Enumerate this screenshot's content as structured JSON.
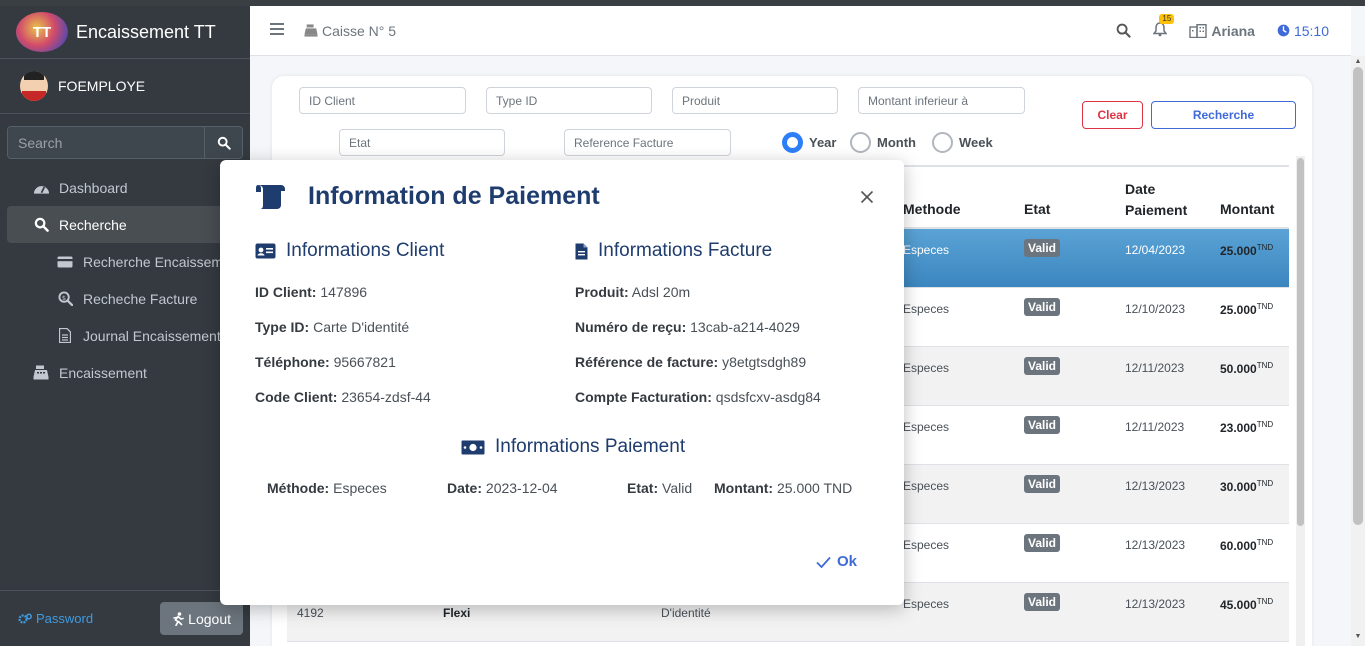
{
  "app": {
    "title": "Encaissement TT",
    "logo_text": "TT"
  },
  "user": {
    "name": "FOEMPLOYE"
  },
  "sidebar": {
    "search_placeholder": "Search",
    "items": [
      {
        "label": "Dashboard",
        "icon": "dashboard-icon"
      },
      {
        "label": "Recherche",
        "icon": "search-icon"
      },
      {
        "label": "Recherche Encaissement",
        "icon": "credit-card-icon"
      },
      {
        "label": "Recheche Facture",
        "icon": "search-dollar-icon"
      },
      {
        "label": "Journal Encaissement",
        "icon": "file-icon"
      },
      {
        "label": "Encaissement",
        "icon": "cash-register-icon"
      }
    ],
    "password_label": "Password",
    "logout_label": "Logout"
  },
  "header": {
    "caisse": "Caisse N° 5",
    "notif_count": "15",
    "location": "Ariana",
    "time": "15:10"
  },
  "filters": {
    "id_client_ph": "ID Client",
    "type_id_ph": "Type ID",
    "produit_ph": "Produit",
    "montant_ph": "Montant inferieur à",
    "etat_ph": "Etat",
    "ref_ph": "Reference Facture",
    "radio_year": "Year",
    "radio_month": "Month",
    "radio_week": "Week",
    "clear_label": "Clear",
    "search_label": "Recherche"
  },
  "table": {
    "headers": {
      "methode": "Methode",
      "etat": "Etat",
      "date": "Date Paiement",
      "montant": "Montant"
    },
    "currency": "TND",
    "rows": [
      {
        "methode": "Especes",
        "etat": "Valid",
        "date": "12/04/2023",
        "montant": "25.000"
      },
      {
        "methode": "Especes",
        "etat": "Valid",
        "date": "12/10/2023",
        "montant": "25.000"
      },
      {
        "methode": "Especes",
        "etat": "Valid",
        "date": "12/11/2023",
        "montant": "50.000"
      },
      {
        "methode": "Especes",
        "etat": "Valid",
        "date": "12/11/2023",
        "montant": "23.000"
      },
      {
        "methode": "Especes",
        "etat": "Valid",
        "date": "12/13/2023",
        "montant": "30.000"
      },
      {
        "methode": "Especes",
        "etat": "Valid",
        "date": "12/13/2023",
        "montant": "60.000"
      },
      {
        "methode": "Especes",
        "etat": "Valid",
        "date": "12/13/2023",
        "montant": "45.000"
      }
    ],
    "last_row_partial": {
      "code_tail": "4192",
      "product": "Flexi",
      "type_id": "D'identité"
    }
  },
  "modal": {
    "title": "Information de Paiement",
    "client_heading": "Informations Client",
    "facture_heading": "Informations Facture",
    "paiement_heading": "Informations Paiement",
    "client": {
      "id_label": "ID Client:",
      "id_value": "147896",
      "type_label": "Type ID:",
      "type_value": "Carte D'identité",
      "tel_label": "Téléphone:",
      "tel_value": "95667821",
      "code_label": "Code Client:",
      "code_value": "23654-zdsf-44"
    },
    "facture": {
      "produit_label": "Produit:",
      "produit_value": "Adsl 20m",
      "recu_label": "Numéro de reçu:",
      "recu_value": "13cab-a214-4029",
      "ref_label": "Référence de facture:",
      "ref_value": "y8etgtsdgh89",
      "compte_label": "Compte Facturation:",
      "compte_value": "qsdsfcxv-asdg84"
    },
    "paiement": {
      "methode_label": "Méthode:",
      "methode_value": "Especes",
      "date_label": "Date:",
      "date_value": "2023-12-04",
      "etat_label": "Etat:",
      "etat_value": "Valid",
      "montant_label": "Montant:",
      "montant_value": "25.000 TND"
    },
    "ok_label": "Ok"
  },
  "colors": {
    "sidebar": "#343a40",
    "accent": "#3f6ad8",
    "title": "#1f3c6e",
    "selected_row": "#3b86bf",
    "danger": "#dc3545"
  }
}
